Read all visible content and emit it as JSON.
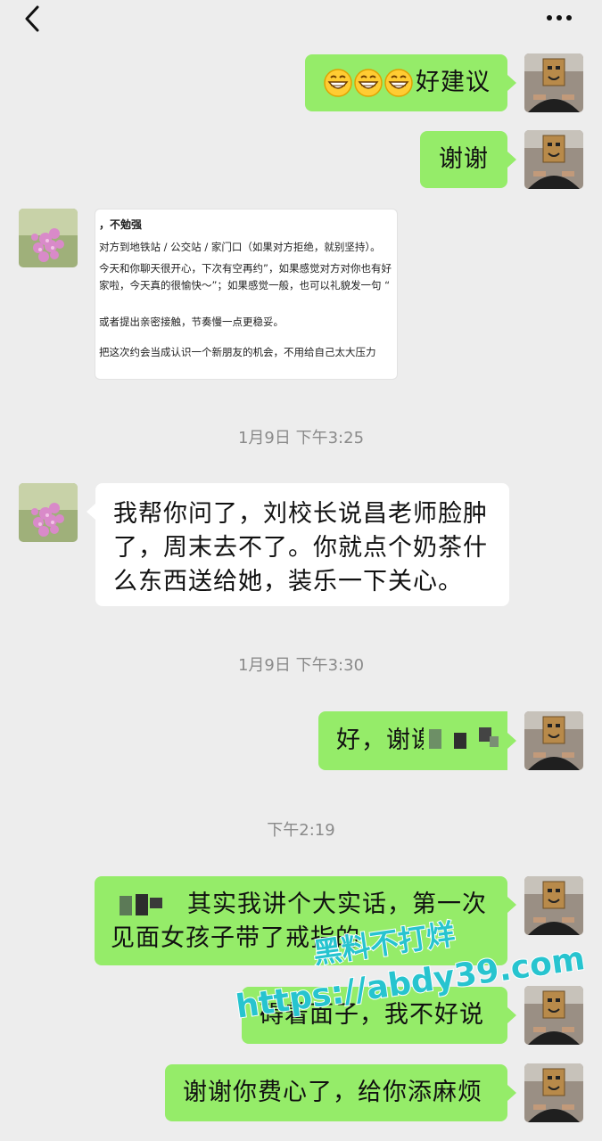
{
  "header": {
    "back_icon": "chevron-left-icon",
    "title": "",
    "more_icon": "more-dots-icon"
  },
  "messages": [
    {
      "side": "right",
      "emoji": [
        "grinning-face-icon",
        "grinning-face-icon",
        "grinning-face-icon"
      ],
      "text": "好建议"
    },
    {
      "side": "right",
      "text": "谢谢"
    },
    {
      "side": "left",
      "type": "image",
      "screenshot_lines": [
        "，不勉强",
        "对方到地铁站 / 公交站 / 家门口（如果对方拒绝，就别坚持）。",
        "今天和你聊天很开心，下次有空再约”，如果感觉对方对你也有好",
        "家啦，今天真的很愉快～”；如果感觉一般，也可以礼貌发一句 “",
        "或者提出亲密接触，节奏慢一点更稳妥。",
        "把这次约会当成认识一个新朋友的机会，不用给自己太大压力"
      ]
    },
    {
      "type": "time",
      "text": "1月9日 下午3:25"
    },
    {
      "side": "left",
      "lines": [
        "我帮你问了，刘校长说昌老师脸肿",
        "了，周末去不了。你就点个奶茶什",
        "么东西送给她，装乐一下关心。"
      ]
    },
    {
      "type": "time",
      "text": "1月9日 下午3:30"
    },
    {
      "side": "right",
      "text": "好，谢谢"
    },
    {
      "type": "time",
      "text": "下午2:19"
    },
    {
      "side": "right",
      "lines": [
        "其实我讲个大实话，第一次",
        "见面女孩子带了戒指的"
      ]
    },
    {
      "side": "right",
      "text": "碍着面子，我不好说"
    },
    {
      "side": "right",
      "text": "谢谢你费心了，给你添麻烦"
    }
  ],
  "watermark": {
    "line1": "黑料不打烊",
    "line2": "https://abdy39.com",
    "color": "#27c4cf"
  },
  "colors": {
    "background": "#ededed",
    "sent_bubble": "#95ec69",
    "received_bubble": "#ffffff"
  }
}
